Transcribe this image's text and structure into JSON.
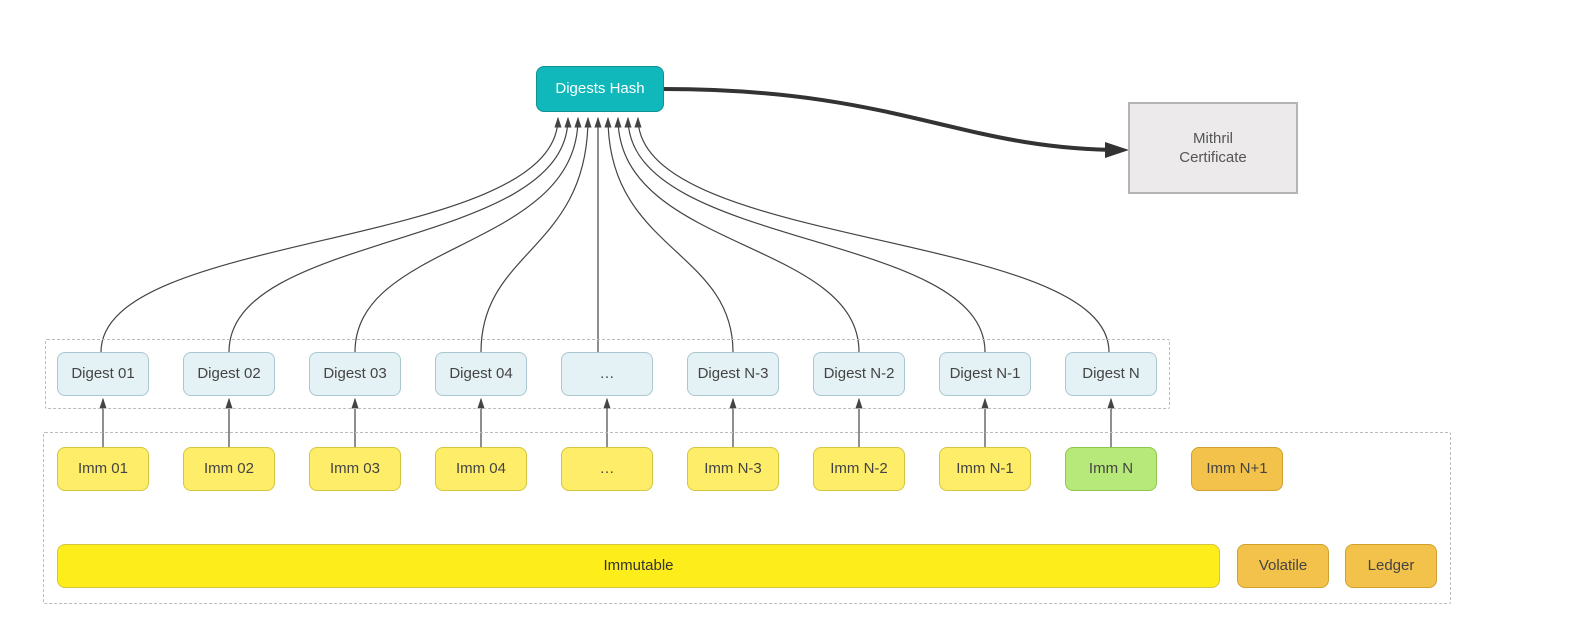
{
  "top": {
    "digests_hash": "Digests Hash",
    "certificate_line1": "Mithril",
    "certificate_line2": "Certificate"
  },
  "digests": {
    "d0": "Digest 01",
    "d1": "Digest 02",
    "d2": "Digest 03",
    "d3": "Digest 04",
    "d4": "…",
    "d5": "Digest N-3",
    "d6": "Digest N-2",
    "d7": "Digest N-1",
    "d8": "Digest N"
  },
  "imms": {
    "i0": "Imm 01",
    "i1": "Imm 02",
    "i2": "Imm 03",
    "i3": "Imm 04",
    "i4": "…",
    "i5": "Imm N-3",
    "i6": "Imm N-2",
    "i7": "Imm N-1",
    "i8": "Imm N",
    "i9": "Imm N+1"
  },
  "bottom": {
    "immutable": "Immutable",
    "volatile": "Volatile",
    "ledger": "Ledger"
  },
  "colors": {
    "hash_bg": "#10b8bb",
    "digest_bg": "#e5f2f5",
    "imm_yellow": "#fded69",
    "imm_green": "#b7e87a",
    "imm_orange": "#f3c24a",
    "immutable_bar": "#fded1b",
    "certificate_bg": "#eceaea"
  }
}
